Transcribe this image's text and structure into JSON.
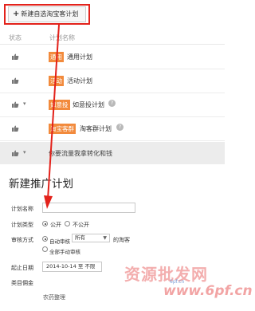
{
  "new_plan_button": {
    "plus": "+",
    "label": "新建自选淘宝客计划"
  },
  "table": {
    "headers": {
      "status": "状态",
      "plan_name": "计划名称"
    },
    "rows": [
      {
        "tag": "通用",
        "name": "通用计划"
      },
      {
        "tag": "活动",
        "name": "活动计划"
      },
      {
        "tag": "如意投",
        "name": "如意投计划",
        "help": "?"
      },
      {
        "tag": "淘宝客群",
        "name": "淘客群计划",
        "help": "?"
      }
    ],
    "promo_row": {
      "text": "你要流量我拿转化和钱"
    }
  },
  "form": {
    "title": "新建推广计划",
    "plan_name_label": "计划名称",
    "plan_name_value": "",
    "plan_type_label": "计划类型",
    "plan_type_options": [
      "公开",
      "不公开"
    ],
    "review_label": "审核方式",
    "review_options": [
      "自动审核",
      "全部手动审核"
    ],
    "review_select_value": "所有",
    "review_suffix": "的淘客",
    "start_date_label": "起止日期",
    "start_date_value": "2014-10-14 至 不限",
    "category_commission_label": "类目佣金",
    "category_sub_label": "农药整理"
  },
  "watermark": {
    "cn": "资源批发网",
    "url": "www.6pf.cn",
    "small": "6pf.cn"
  },
  "colors": {
    "accent_red": "#e3221b",
    "tag_orange": "#f28a3c"
  }
}
